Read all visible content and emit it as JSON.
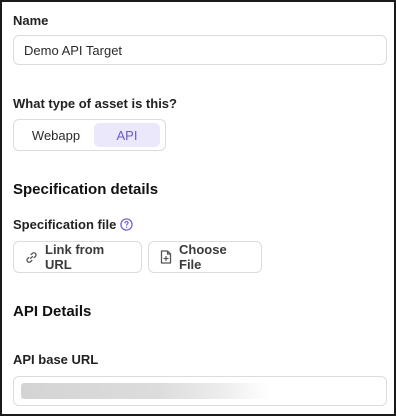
{
  "form": {
    "name_label": "Name",
    "name_value": "Demo API Target",
    "asset_type_label": "What type of asset is this?",
    "asset_type_options": [
      "Webapp",
      "API"
    ],
    "asset_type_selected": "API",
    "spec_section_title": "Specification details",
    "spec_file_label": "Specification file",
    "link_from_url_label": "Link from URL",
    "choose_file_label": "Choose File",
    "api_details_title": "API Details",
    "api_base_url_label": "API base URL"
  },
  "icons": {
    "help": "help-circle-icon",
    "link": "link-icon",
    "file": "file-plus-icon"
  },
  "colors": {
    "accent": "#6b5acd",
    "accent_bg": "#ece8fb"
  }
}
